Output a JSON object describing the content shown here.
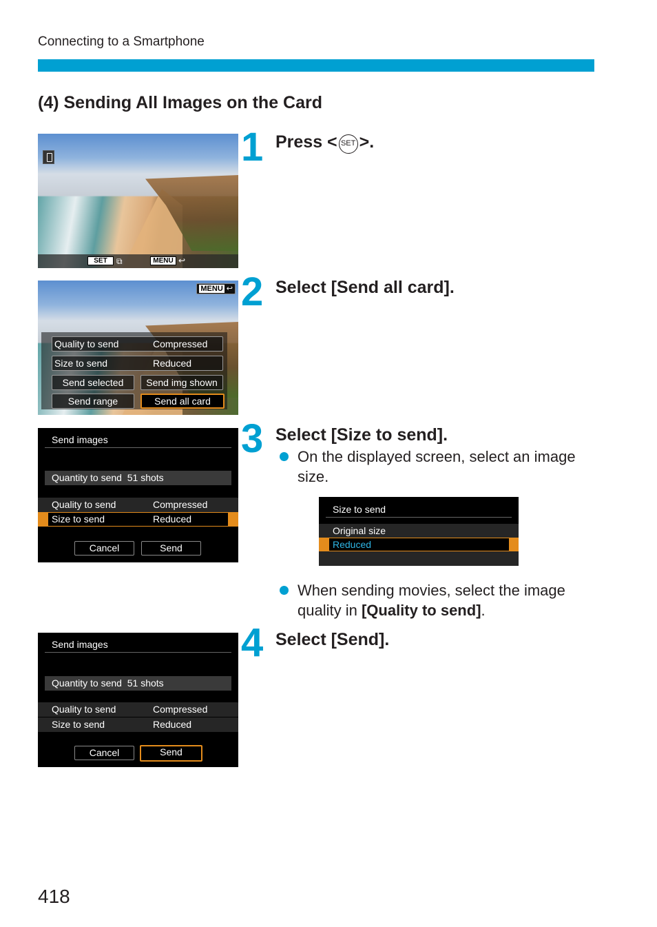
{
  "header": {
    "running_head": "Connecting to a Smartphone",
    "accent_color": "#00a0d2"
  },
  "section_title": "(4) Sending All Images on the Card",
  "steps": [
    {
      "number": "1",
      "title_prefix": "Press <",
      "title_icon": "SET",
      "title_suffix": ">."
    },
    {
      "number": "2",
      "title": "Select [Send all card]."
    },
    {
      "number": "3",
      "title": "Select [Size to send].",
      "bullets": [
        "On the displayed screen, select an image size.",
        {
          "prefix": "When sending movies, select the image quality in ",
          "bold": "[Quality to send]",
          "suffix": "."
        }
      ]
    },
    {
      "number": "4",
      "title": "Select [Send]."
    }
  ],
  "screen1": {
    "set_key": "SET",
    "menu_key": "MENU"
  },
  "screen2": {
    "menu_key": "MENU",
    "rows": [
      {
        "label": "Quality to send",
        "value": "Compressed"
      },
      {
        "label": "Size to send",
        "value": "Reduced"
      }
    ],
    "buttons": [
      "Send selected",
      "Send img shown",
      "Send range",
      "Send all card"
    ],
    "selected_button": "Send all card",
    "highlight_color": "#e48c1c"
  },
  "screen3": {
    "title": "Send images",
    "quantity_label": "Quantity to send",
    "quantity_value": "51 shots",
    "rows": [
      {
        "label": "Quality to send",
        "value": "Compressed"
      },
      {
        "label": "Size to send",
        "value": "Reduced"
      }
    ],
    "selected_row": "Size to send",
    "cancel": "Cancel",
    "send": "Send"
  },
  "size_screen": {
    "title": "Size to send",
    "options": [
      "Original size",
      "Reduced"
    ],
    "selected": "Reduced",
    "selected_text_color": "#2fb6e6"
  },
  "screen4": {
    "title": "Send images",
    "quantity_label": "Quantity to send",
    "quantity_value": "51 shots",
    "rows": [
      {
        "label": "Quality to send",
        "value": "Compressed"
      },
      {
        "label": "Size to send",
        "value": "Reduced"
      }
    ],
    "cancel": "Cancel",
    "send": "Send",
    "selected_button": "Send"
  },
  "page_number": "418"
}
